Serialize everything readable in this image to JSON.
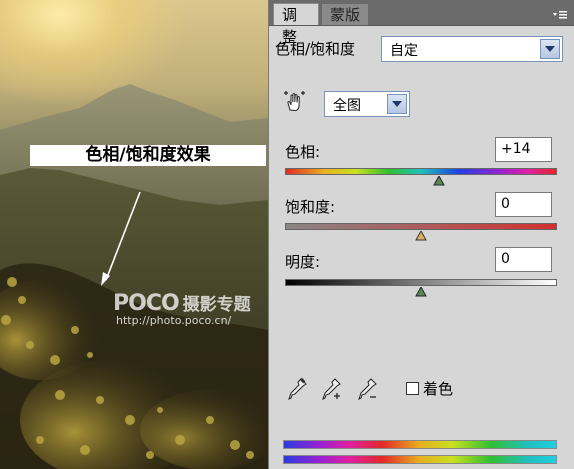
{
  "photo": {
    "effect_label": "色相/饱和度效果",
    "watermark_logo": "POCO",
    "watermark_title": "摄影专题",
    "watermark_url": "http://photo.poco.cn/"
  },
  "panel": {
    "tabs": [
      {
        "label": "调整",
        "active": true
      },
      {
        "label": "蒙版",
        "active": false
      }
    ],
    "header_label": "色相/饱和度",
    "preset_value": "自定",
    "range_value": "全图",
    "hue": {
      "label": "色相:",
      "value": "+14"
    },
    "saturation": {
      "label": "饱和度:",
      "value": "0"
    },
    "lightness": {
      "label": "明度:",
      "value": "0"
    },
    "colorize_label": "着色",
    "colorize_checked": false
  }
}
